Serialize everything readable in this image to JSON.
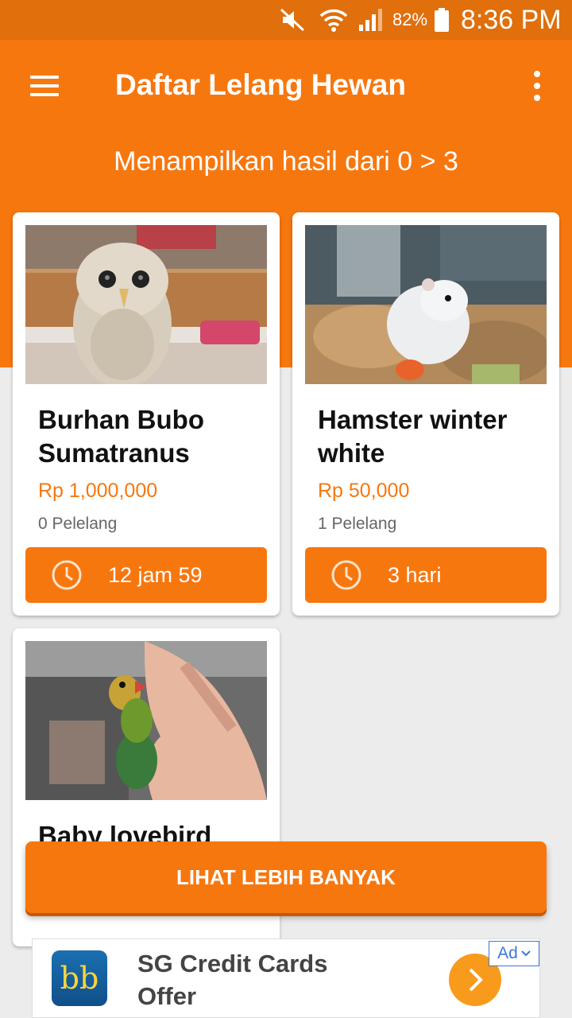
{
  "status_bar": {
    "battery": "82%",
    "time": "8:36 PM"
  },
  "app_bar": {
    "title": "Daftar Lelang Hewan",
    "subtitle": "Menampilkan hasil dari 0 > 3"
  },
  "listings": [
    {
      "title": "Burhan Bubo Sumatranus",
      "price": "Rp 1,000,000",
      "bidders": "0 Pelelang",
      "time_left": "12 jam 59",
      "image": "owl-photo"
    },
    {
      "title": "Hamster winter white",
      "price": "Rp 50,000",
      "bidders": "1 Pelelang",
      "time_left": "3 hari",
      "image": "hamster-photo"
    },
    {
      "title": "Baby lovebird",
      "price": "",
      "bidders": "",
      "time_left": "",
      "image": "lovebird-photo"
    }
  ],
  "load_more": {
    "label": "LIHAT LEBIH BANYAK"
  },
  "ad": {
    "logo_text": "bb",
    "text": "SG Credit Cards Offer",
    "badge": "Ad"
  },
  "colors": {
    "primary": "#f7770f",
    "status_bar": "#e06f0c",
    "price": "#f7770f",
    "ad_arrow": "#f89a1c"
  }
}
